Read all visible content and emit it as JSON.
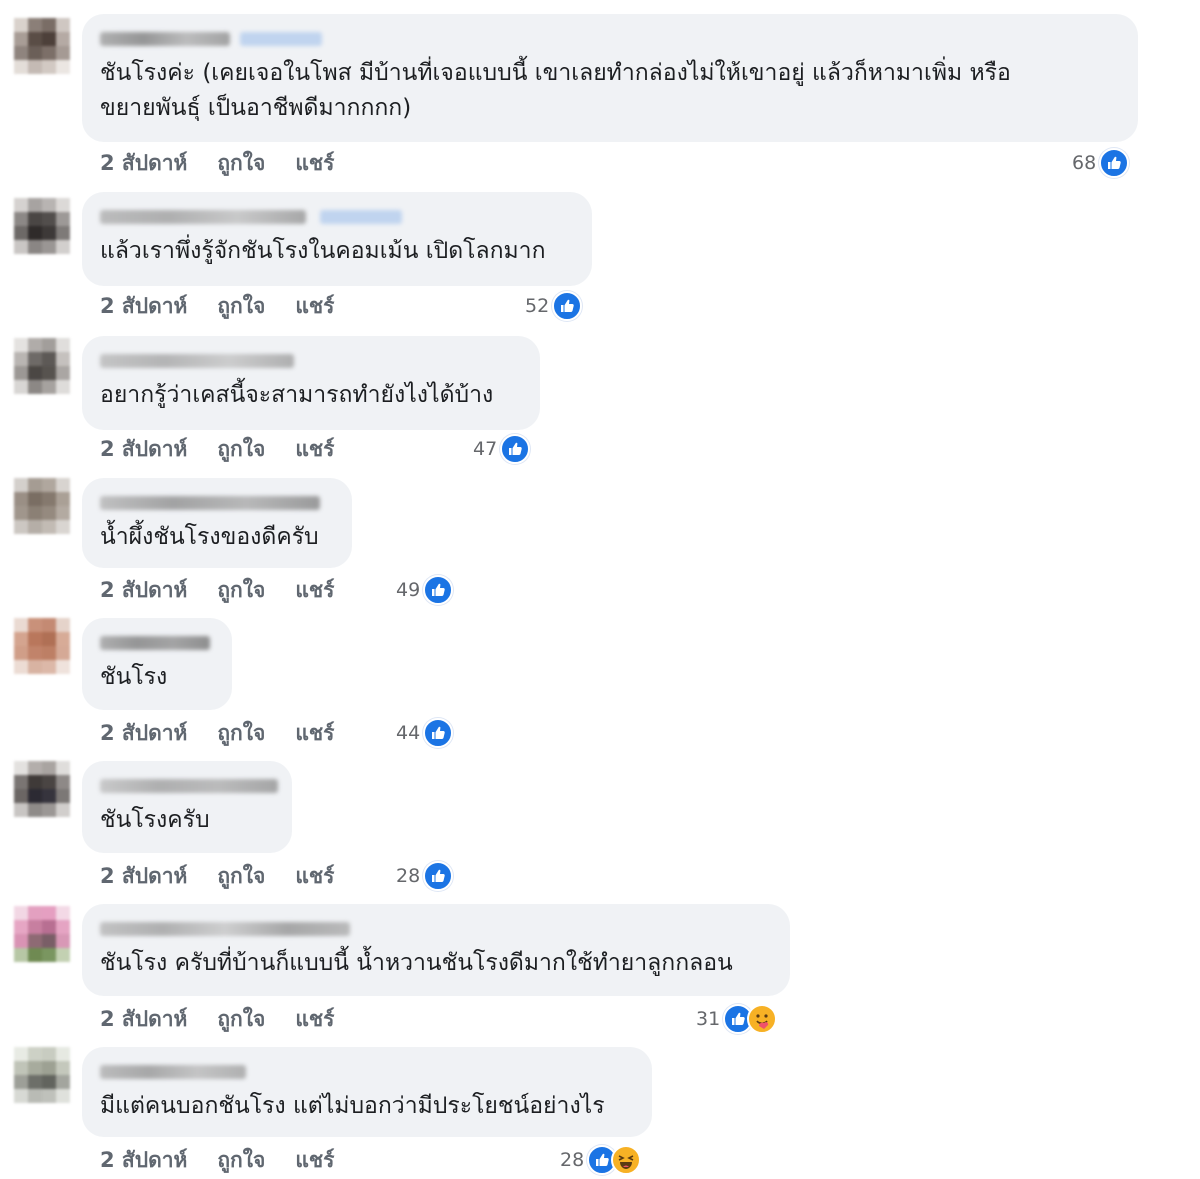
{
  "labels": {
    "time": "2 สัปดาห์",
    "like": "ถูกใจ",
    "share": "แชร์"
  },
  "colors": {
    "like_blue": "#1b74e4",
    "bubble_bg": "#f0f2f5",
    "meta_text": "#606770"
  },
  "comments": [
    {
      "text": "ชันโรงค่ะ (เคยเจอในโพส มีบ้านที่เจอแบบนี้ เขาเลยทำกล่องไม่ให้เขาอยู่ แล้วก็หามาเพิ่ม หรือ\nขยายพันธุ์ เป็นอาชีพดีมากกกก)",
      "count": "68",
      "reactions": [
        "like-icon"
      ]
    },
    {
      "text": "แล้วเราพึ่งรู้จักชันโรงในคอมเม้น เปิดโลกมาก",
      "count": "52",
      "reactions": [
        "like-icon"
      ]
    },
    {
      "text": "อยากรู้ว่าเคสนี้จะสามารถทำยังไงได้บ้าง",
      "count": "47",
      "reactions": [
        "like-icon"
      ]
    },
    {
      "text": "น้ำผึ้งชันโรงของดีครับ",
      "count": "49",
      "reactions": [
        "like-icon"
      ]
    },
    {
      "text": "ชันโรง",
      "count": "44",
      "reactions": [
        "like-icon"
      ]
    },
    {
      "text": "ชันโรงครับ",
      "count": "28",
      "reactions": [
        "like-icon"
      ]
    },
    {
      "text": "ชันโรง ครับที่บ้านก็แบบนี้ น้ำหวานชันโรงดีมากใช้ทำยาลูกกลอน",
      "count": "31",
      "reactions": [
        "like-icon",
        "care-icon"
      ]
    },
    {
      "text": "มีแต่คนบอกชันโรง แต่ไม่บอกว่ามีประโยชน์อย่างไร",
      "count": "28",
      "reactions": [
        "like-icon",
        "haha-icon"
      ]
    }
  ]
}
